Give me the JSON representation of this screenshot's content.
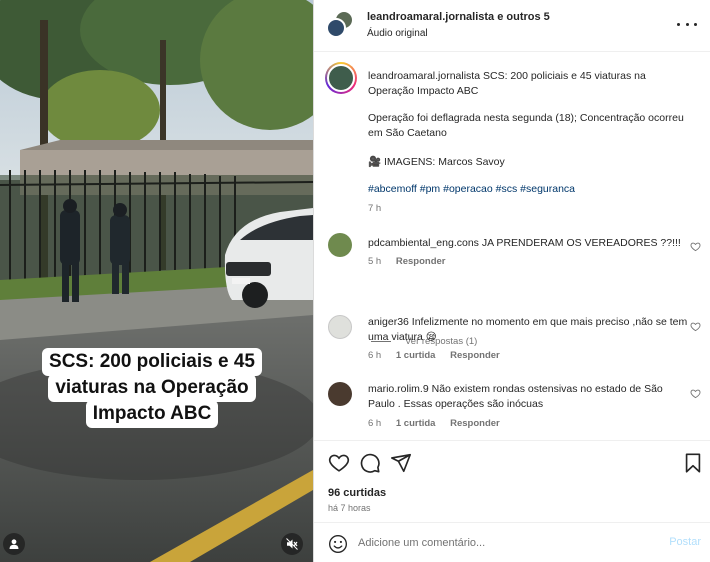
{
  "media": {
    "caption_lines": [
      "SCS:  200 policiais e 45",
      "viaturas na Operação",
      "Impacto ABC"
    ],
    "user_icon": "person-icon",
    "mute_icon": "speaker-muted-icon"
  },
  "header": {
    "title": "leandroamaral.jornalista e outros 5",
    "subtitle": "Áudio original",
    "more_icon": "more-horizontal-icon"
  },
  "post": {
    "user": "leandroamaral.jornalista",
    "text": "SCS: 200 policiais e 45 viaturas na Operação Impacto ABC",
    "body": "Operação foi deflagrada nesta segunda (18); Concentração ocorreu em São Caetano",
    "credit": "🎥 IMAGENS: Marcos Savoy",
    "tags": "#abcemoff #pm #operacao #scs #seguranca",
    "time": "7 h"
  },
  "comments": [
    {
      "user": "pdcambiental_eng.cons",
      "text": "JA PRENDERAM OS VEREADORES ??!!!",
      "time": "5 h",
      "likes": "",
      "reply": "Responder"
    },
    {
      "user": "aniger36",
      "text": "Infelizmente no momento em que mais preciso ,não se tem uma viatura 😪",
      "time": "6 h",
      "likes": "1 curtida",
      "reply": "Responder"
    },
    {
      "user": "mario.rolim.9",
      "text": "Não existem rondas ostensivas no estado de São Paulo . Essas operações são inócuas",
      "time": "6 h",
      "likes": "1 curtida",
      "reply": "Responder"
    }
  ],
  "view_replies": "Ver respostas (1)",
  "actions": {
    "likes": "96 curtidas",
    "when": "há 7 horas"
  },
  "composer": {
    "placeholder": "Adicione um comentário...",
    "post_label": "Postar"
  },
  "colors": {
    "link": "#00376b",
    "muted": "#737373",
    "post_button": "#b2dffc"
  }
}
